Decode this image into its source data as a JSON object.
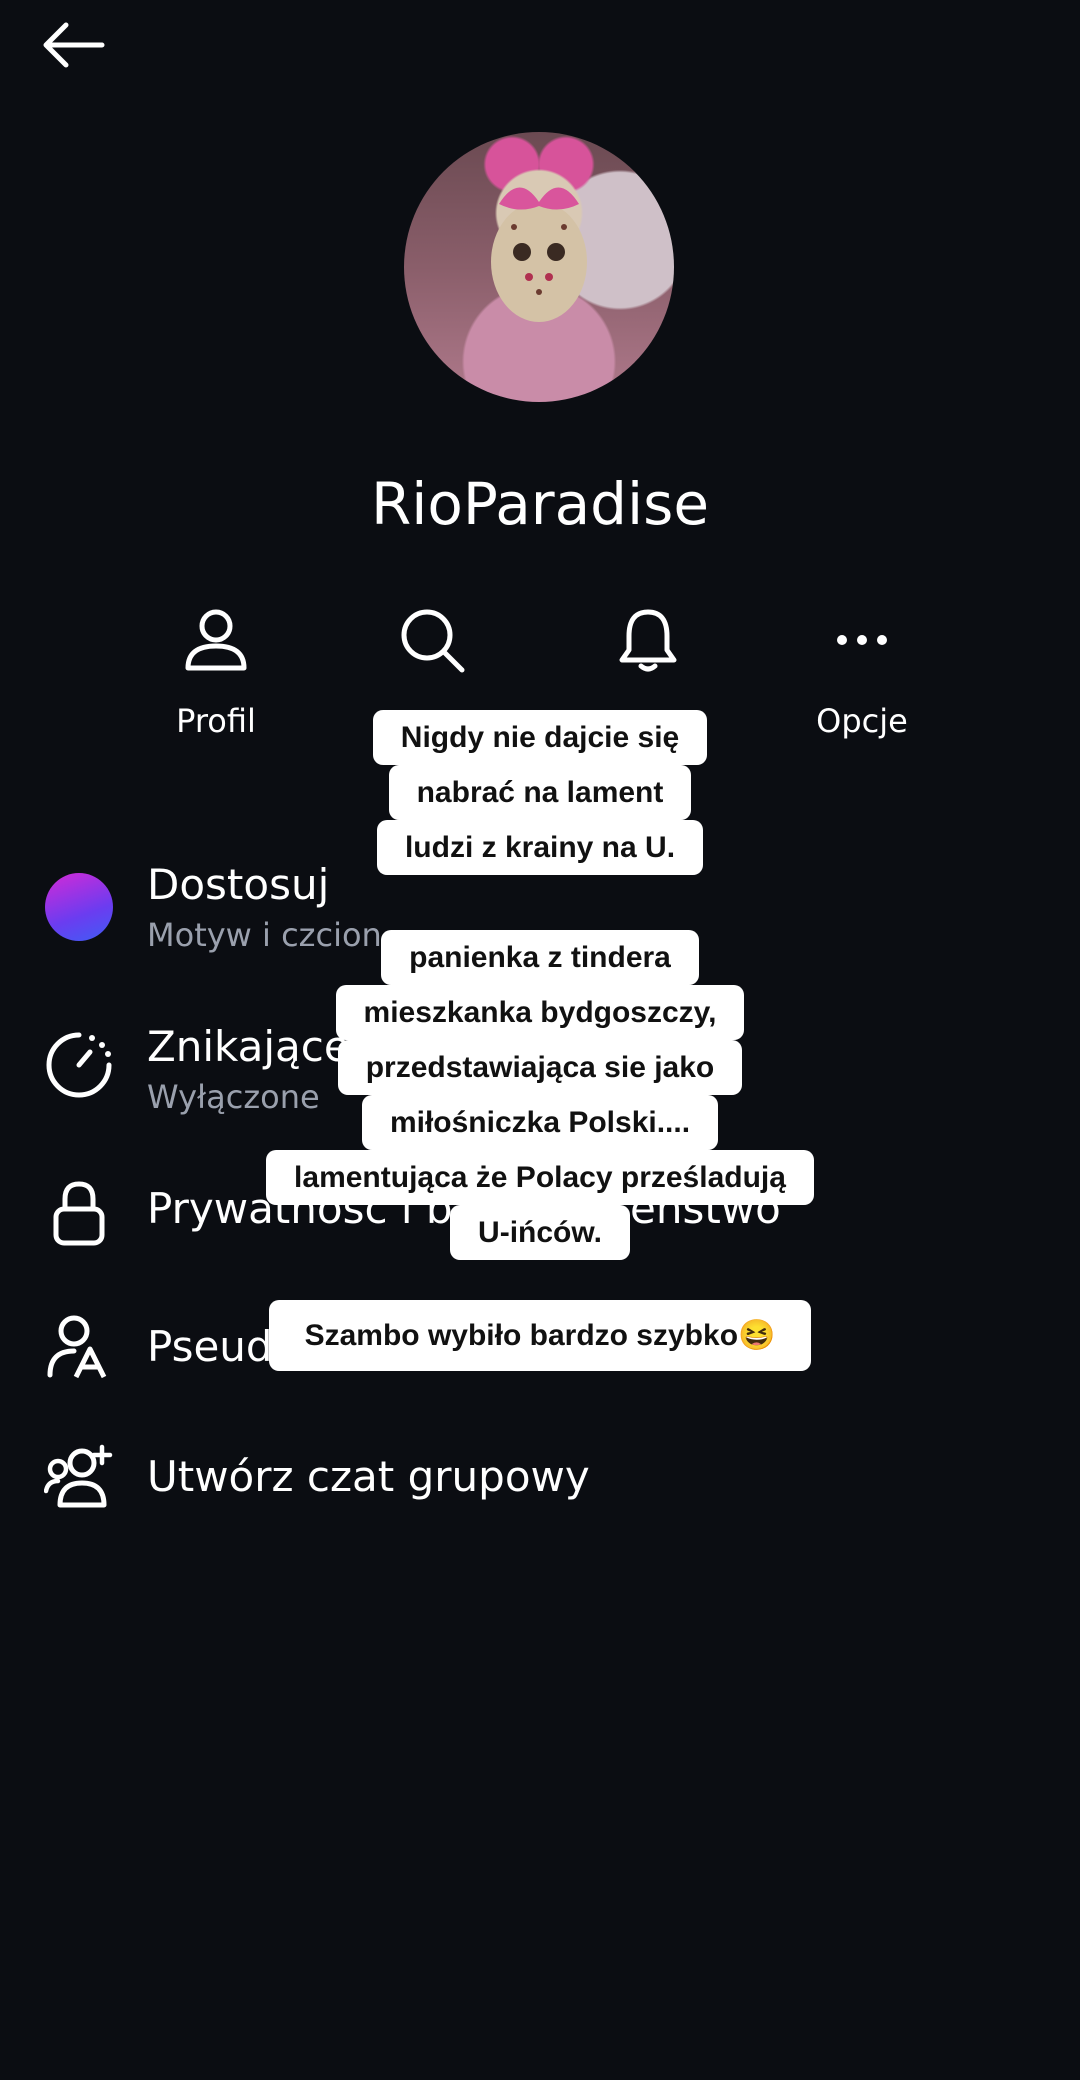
{
  "header": {
    "back_icon": "arrow-left-icon"
  },
  "profile": {
    "name": "RioParadise",
    "avatar_desc_icon": "avatar-image"
  },
  "actions": [
    {
      "label": "Profil",
      "icon": "person-icon"
    },
    {
      "label": "",
      "icon": "search-icon"
    },
    {
      "label": "",
      "icon": "bell-icon"
    },
    {
      "label": "Opcje",
      "icon": "more-icon"
    }
  ],
  "menu": {
    "customize": {
      "title": "Dostosuj",
      "subtitle": "Motyw i czcion"
    },
    "disappearing": {
      "title": "Znikające",
      "subtitle": "Wyłączone"
    },
    "privacy": {
      "title": "Prywatność i b",
      "title_end": "eństwo"
    },
    "nicknames": {
      "title": "Pseud"
    },
    "group_chat": {
      "title": "Utwórz czat grupowy"
    }
  },
  "overlays": {
    "block1": [
      "Nigdy nie dajcie się",
      "nabrać na lament",
      "ludzi z krainy na U."
    ],
    "block2": [
      "panienka z tindera",
      "mieszkanka bydgoszczy,",
      "przedstawiająca sie jako",
      "miłośniczka Polski....",
      "lamentująca że Polacy prześladują",
      "U-ińców."
    ],
    "block3": [
      "Szambo wybiło bardzo szybko😆"
    ]
  },
  "colors": {
    "background": "#0b0d12",
    "text": "#ffffff",
    "subtext": "#9aa0ad",
    "accent_gradient": [
      "#d42ad6",
      "#3f5df5"
    ]
  }
}
